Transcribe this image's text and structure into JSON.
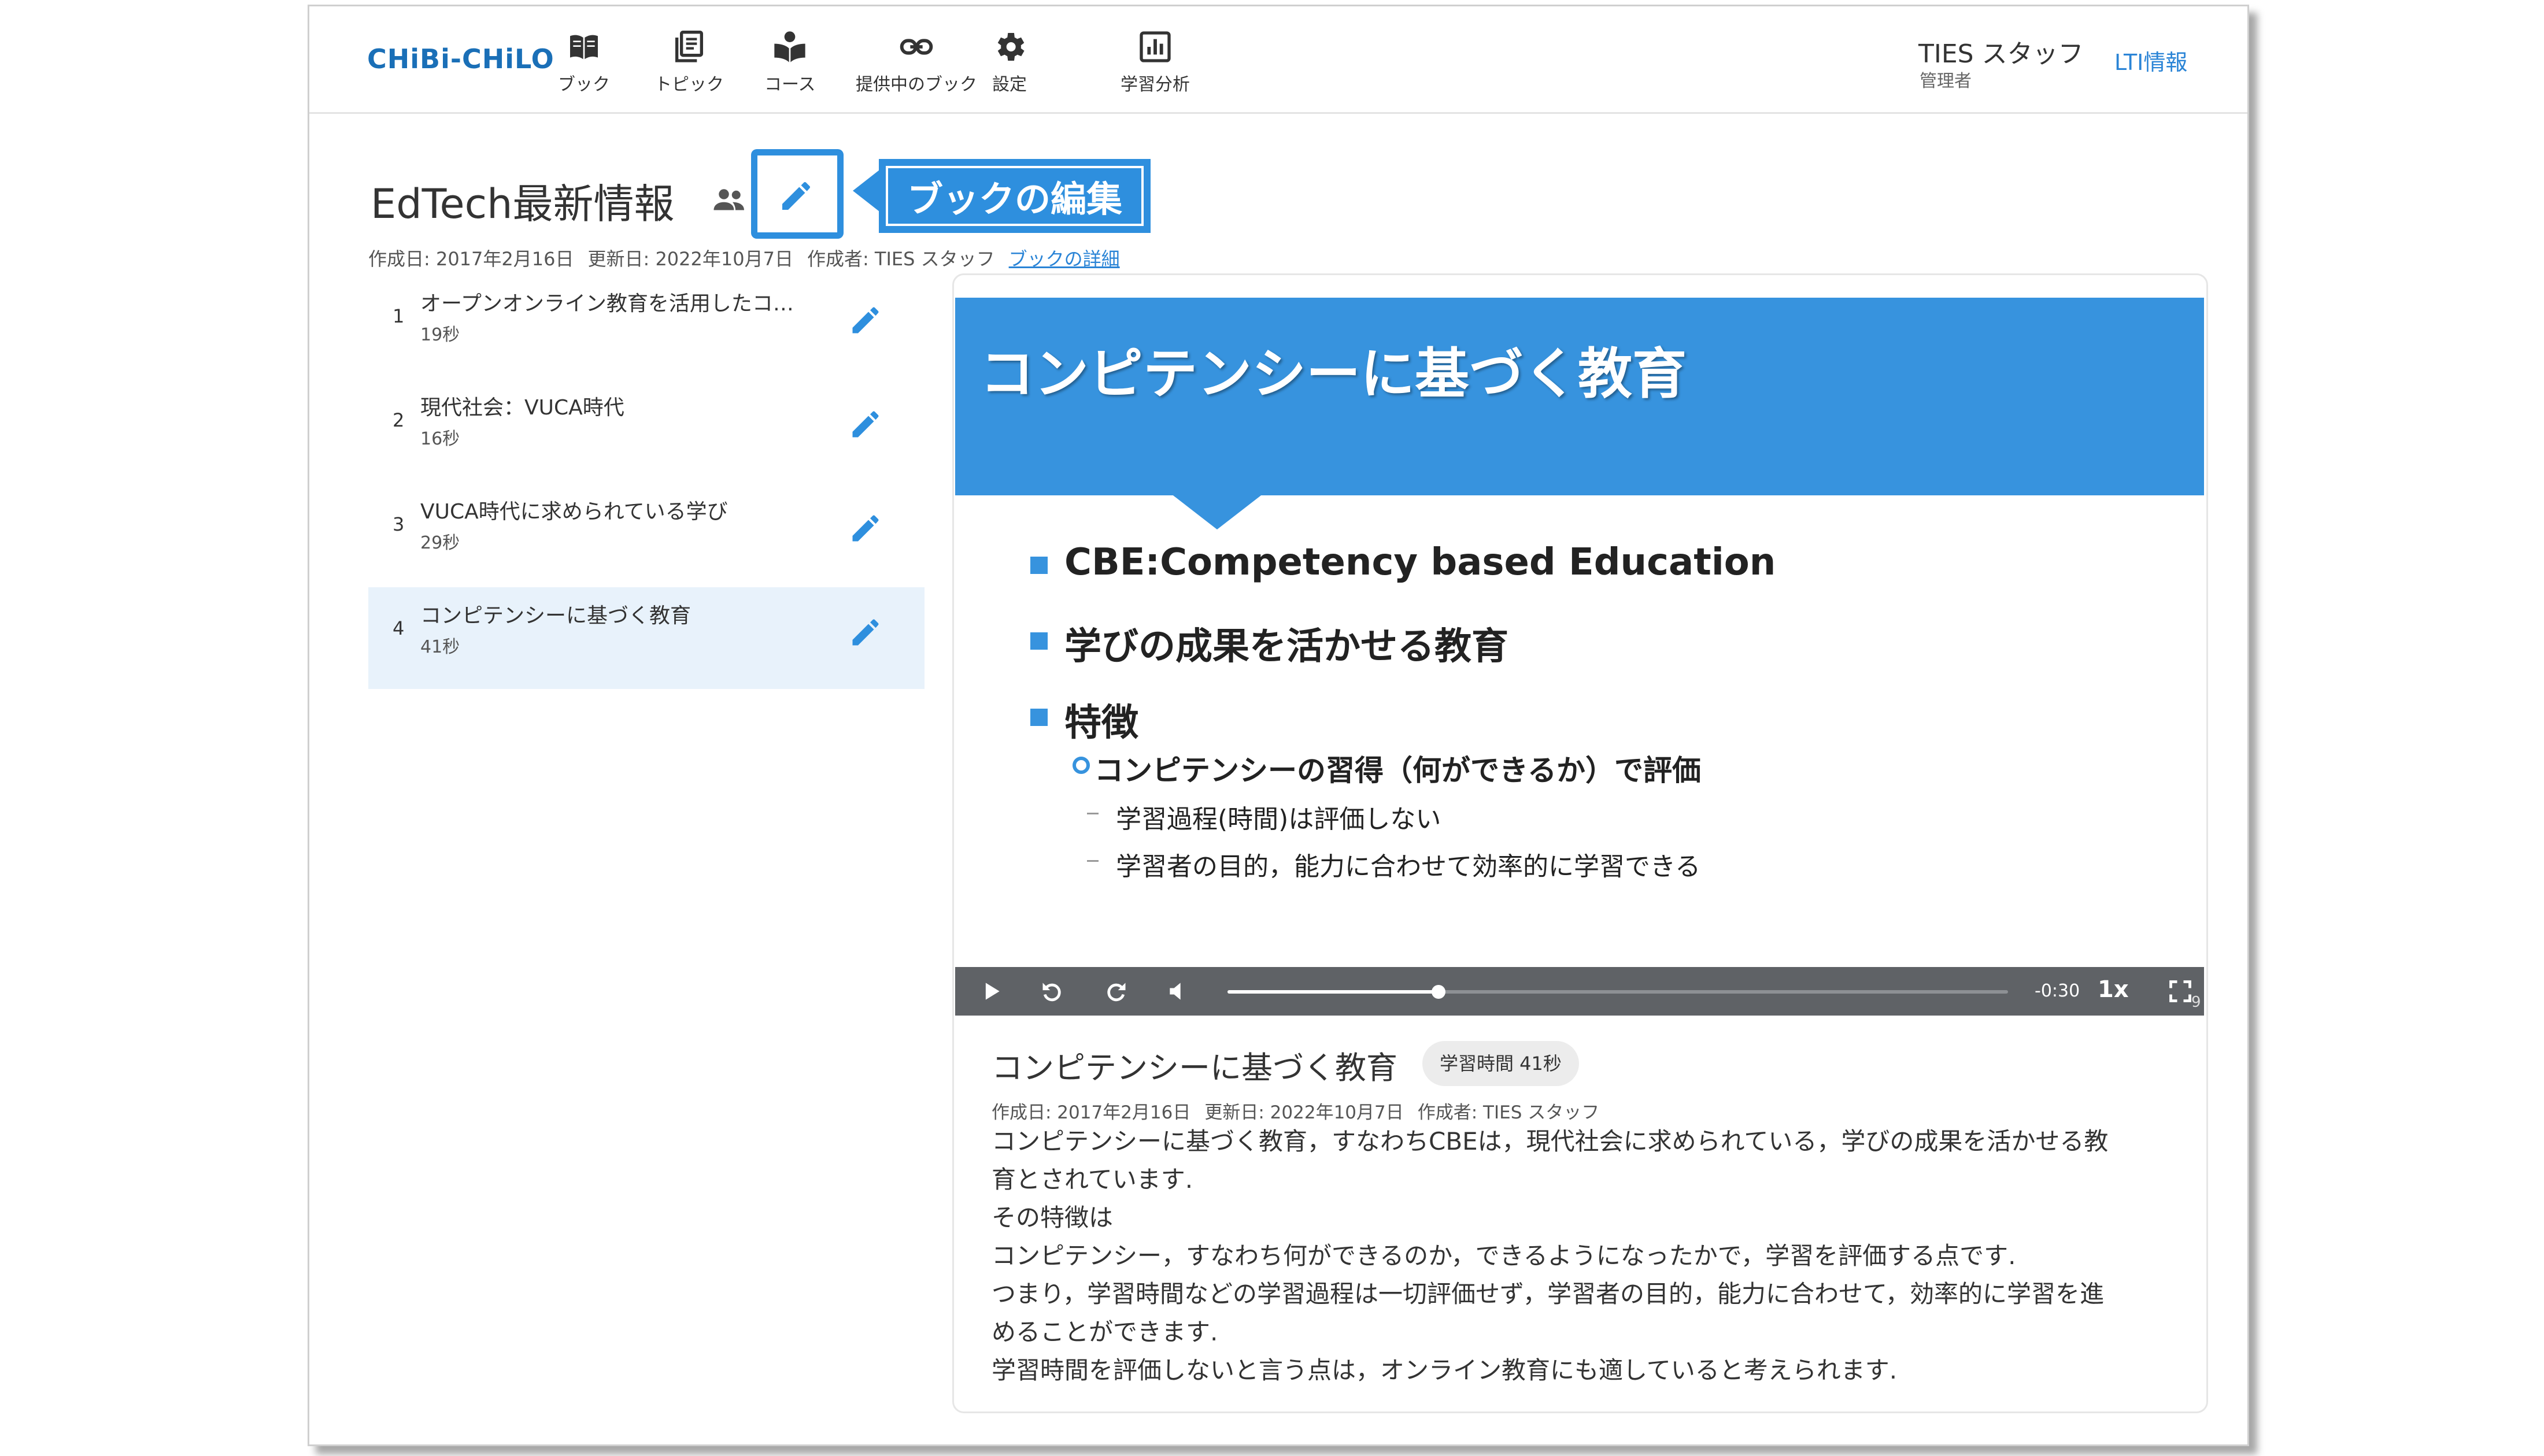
{
  "header": {
    "logo": "CHiBi-CHiLO",
    "nav": [
      {
        "label": "ブック",
        "icon": "book-icon"
      },
      {
        "label": "トピック",
        "icon": "topic-icon"
      },
      {
        "label": "コース",
        "icon": "course-icon"
      },
      {
        "label": "提供中のブック",
        "icon": "link-icon"
      },
      {
        "label": "設定",
        "icon": "gear-icon"
      },
      {
        "label": "学習分析",
        "icon": "analytics-icon"
      }
    ],
    "user_name": "TIES スタッフ",
    "user_role": "管理者",
    "lti_link": "LTI情報"
  },
  "book": {
    "title": "EdTech最新情報",
    "callout": "ブックの編集",
    "created": "作成日: 2017年2月16日",
    "updated": "更新日: 2022年10月7日",
    "author": "作成者: TIES スタッフ",
    "details_link": "ブックの詳細"
  },
  "chapters": [
    {
      "num": "1",
      "title": "オープンオンライン教育を活用したコ…",
      "duration": "19秒"
    },
    {
      "num": "2",
      "title": "現代社会：VUCA時代",
      "duration": "16秒"
    },
    {
      "num": "3",
      "title": "VUCA時代に求められている学び",
      "duration": "29秒"
    },
    {
      "num": "4",
      "title": "コンピテンシーに基づく教育",
      "duration": "41秒",
      "active": true
    }
  ],
  "slide": {
    "title": "コンピテンシーに基づく教育",
    "bullets": [
      "CBE:Competency based Education",
      "学びの成果を活かせる教育",
      "特徴"
    ],
    "sub_bullet": "コンピテンシーの習得（何ができるか）で評価",
    "sub_items": [
      "学習過程(時間)は評価しない",
      "学習者の目的，能力に合わせて効率的に学習できる"
    ]
  },
  "player": {
    "time_remaining": "-0:30",
    "speed": "1x",
    "page_corner": "9",
    "progress": 0.27
  },
  "detail": {
    "title": "コンピテンシーに基づく教育",
    "badge": "学習時間 41秒",
    "created": "作成日: 2017年2月16日",
    "updated": "更新日: 2022年10月7日",
    "author": "作成者: TIES スタッフ",
    "lines": [
      "コンピテンシーに基づく教育，すなわちCBEは，現代社会に求められている，学びの成果を活かせる教",
      "育とされています.",
      "その特徴は",
      "コンピテンシー，すなわち何ができるのか，できるようになったかで，学習を評価する点です.",
      "つまり，学習時間などの学習過程は一切評価せず，学習者の目的，能力に合わせて，効率的に学習を進",
      "めることができます.",
      "学習時間を評価しないと言う点は，オンライン教育にも適していると考えられます."
    ]
  },
  "colors": {
    "accent": "#2e8fde",
    "slide_band": "#3793de",
    "link": "#2a84d6",
    "controls": "#5f6266"
  }
}
